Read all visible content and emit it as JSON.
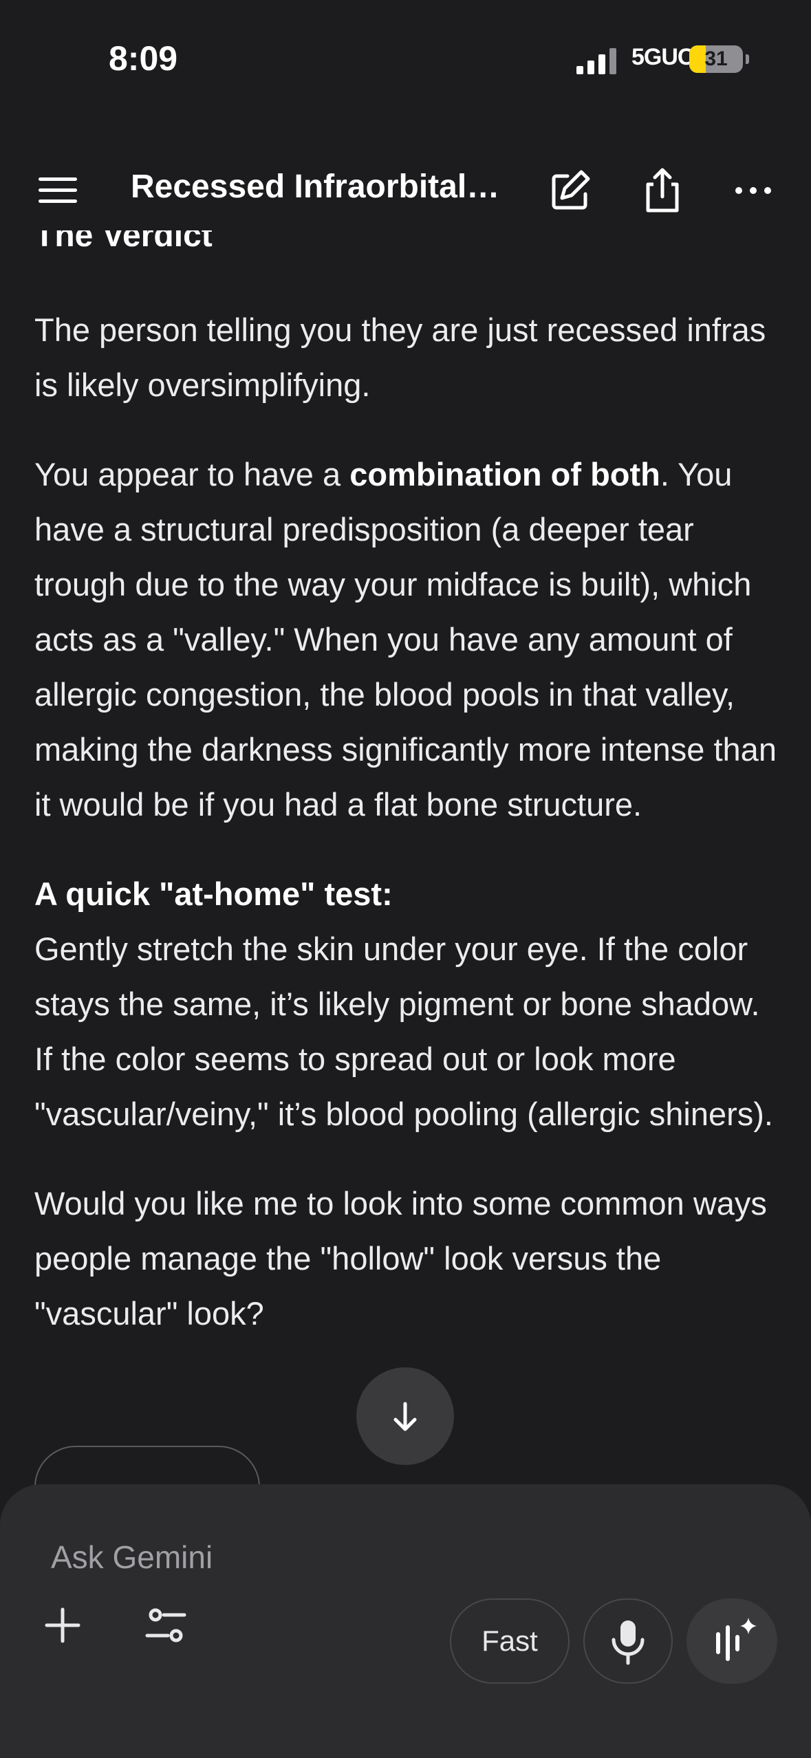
{
  "status_bar": {
    "time": "8:09",
    "network": "5GUC",
    "battery_percent": 31,
    "battery_text": "31",
    "battery_color": "#ffd60a"
  },
  "header": {
    "title": "Recessed Infraorbitals...",
    "icons": [
      "menu-icon",
      "edit-icon",
      "share-icon",
      "more-icon"
    ]
  },
  "response": {
    "clipped_heading": "The Verdict",
    "p1": "The person telling you they are just recessed infras is likely oversimplifying.",
    "p2_before": "You appear to have a ",
    "p2_bold": "combination of both",
    "p2_after": ". You have a structural predisposition (a deeper tear trough due to the way your midface is built), which acts as a \"valley.\" When you have any amount of allergic congestion, the blood pools in that valley, making the darkness significantly more intense than it would be if you had a flat bone structure.",
    "test_heading": "A quick \"at-home\" test:",
    "test_body": "Gently stretch the skin under your eye. If the color stays the same, it’s likely pigment or bone shadow. If the color seems to spread out or look more \"vascular/veiny,\" it’s blood pooling (allergic shiners).",
    "closing": "Would you like me to look into some common ways people manage the \"hollow\" look versus the \"vascular\" look?"
  },
  "composer": {
    "placeholder": "Ask Gemini",
    "mode_label": "Fast",
    "icons": [
      "plus-icon",
      "tools-icon",
      "mic-icon",
      "live-icon",
      "arrow-down-icon"
    ]
  }
}
